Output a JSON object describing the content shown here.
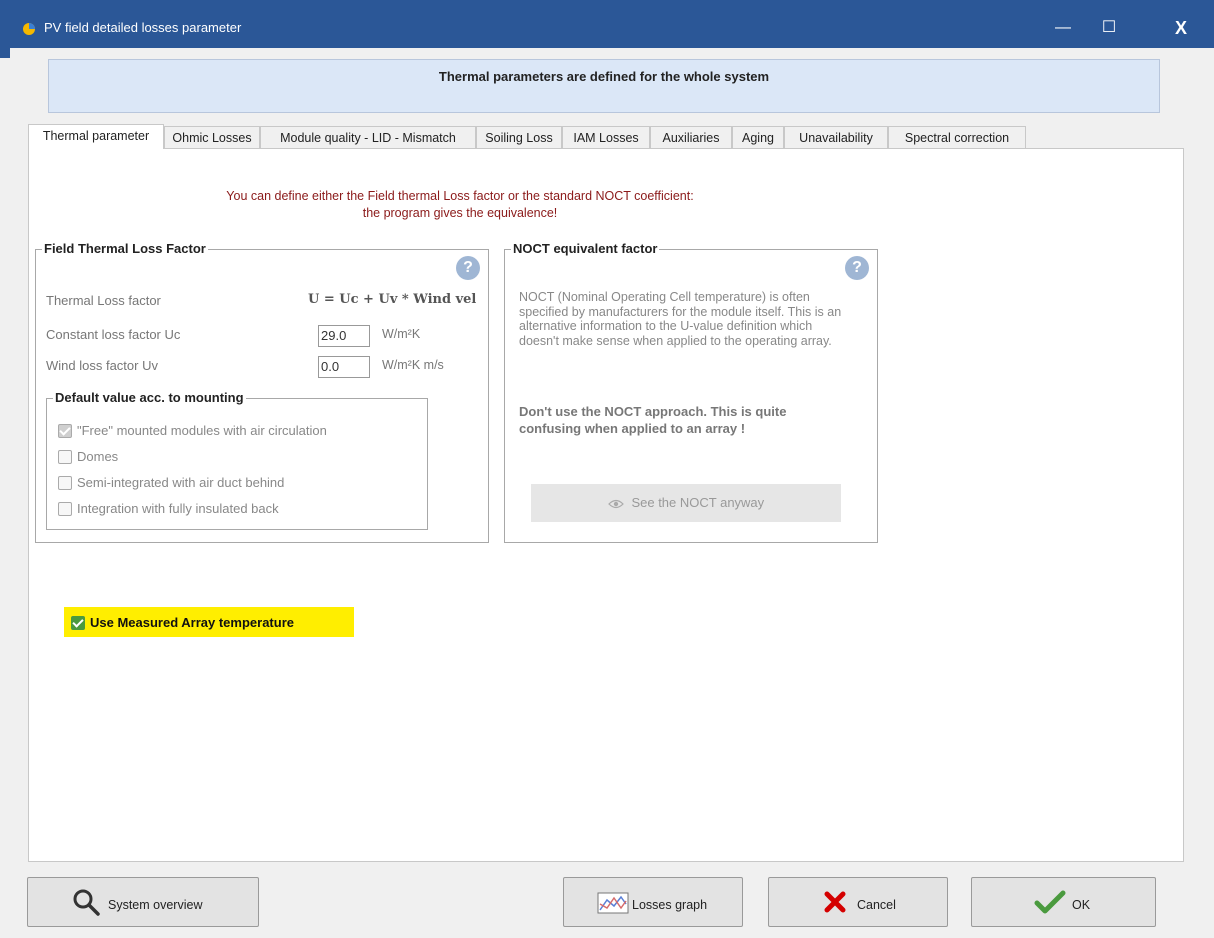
{
  "window": {
    "title": "PV field detailed losses parameter",
    "minimize_glyph": "—",
    "maximize_glyph": "☐",
    "close_glyph": "X"
  },
  "banner": "Thermal parameters are defined for the whole system",
  "tabs": [
    {
      "label": "Thermal parameter",
      "active": true
    },
    {
      "label": "Ohmic Losses"
    },
    {
      "label": "Module quality - LID - Mismatch"
    },
    {
      "label": "Soiling Loss"
    },
    {
      "label": "IAM Losses"
    },
    {
      "label": "Auxiliaries"
    },
    {
      "label": "Aging"
    },
    {
      "label": "Unavailability"
    },
    {
      "label": "Spectral correction"
    }
  ],
  "info": {
    "line1": "You can define either the Field thermal Loss factor or the standard NOCT coefficient:",
    "line2": "the program gives the equivalence!"
  },
  "thermal": {
    "legend": "Field Thermal Loss Factor",
    "help": "?",
    "loss_factor_label": "Thermal Loss factor",
    "formula": "U = Uc + Uv * Wind vel",
    "uc_label": "Constant loss factor Uc",
    "uc_value": "29.0",
    "uc_unit": "W/m²K",
    "uv_label": "Wind loss factor Uv",
    "uv_value": "0.0",
    "uv_unit": "W/m²K m/s",
    "mounting": {
      "legend": "Default value acc. to mounting",
      "options": [
        {
          "label": "\"Free\" mounted modules with air circulation",
          "checked": true
        },
        {
          "label": "Domes",
          "checked": false
        },
        {
          "label": "Semi-integrated with air duct behind",
          "checked": false
        },
        {
          "label": "Integration with fully insulated back",
          "checked": false
        }
      ]
    }
  },
  "noct": {
    "legend": "NOCT equivalent factor",
    "help": "?",
    "text": "NOCT (Nominal Operating Cell temperature) is often specified by manufacturers for the module itself. This is an alternative information to the U-value definition which doesn't make sense when applied to the operating array.",
    "warning": "Don't use the NOCT approach. This is quite confusing when applied to an array !",
    "button_icon": "eye-icon",
    "button_label": "See the NOCT anyway"
  },
  "measured": {
    "label": "Use Measured Array temperature",
    "checked": true
  },
  "buttons": {
    "system_overview": "System overview",
    "losses_graph": "Losses graph",
    "cancel": "Cancel",
    "ok": "OK"
  },
  "colors": {
    "titlebar": "#2b5797",
    "banner": "#dbe7f7",
    "info_text": "#8b1a1a",
    "highlight": "#ffee00",
    "check_green": "#4a9a3e",
    "cancel_red": "#d40000"
  }
}
